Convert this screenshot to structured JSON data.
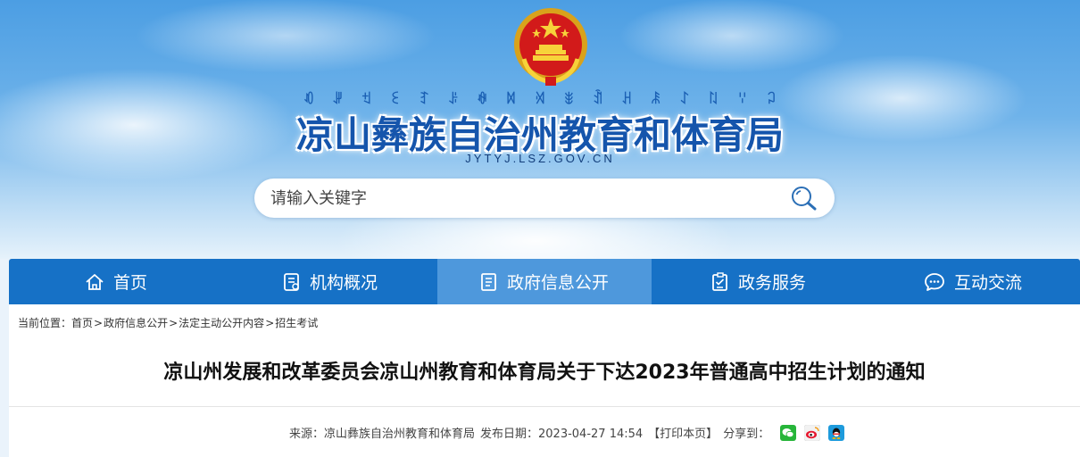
{
  "header": {
    "yi_script": [
      "ꀒ",
      "ꎼ",
      "ꉬ",
      "ꏂ",
      "ꆈ",
      "ꌠ",
      "ꊿ",
      "ꉙ",
      "ꄉ",
      "ꎺ",
      "ꀉ",
      "ꃅ",
      "ꄯ",
      "ꋍ",
      "ꇁ",
      "ꈌ",
      "ꃀ"
    ],
    "site_title": "凉山彝族自治州教育和体育局",
    "site_domain": "JYTYJ.LSZ.GOV.CN"
  },
  "search": {
    "placeholder": "请输入关键字",
    "icon": "search-icon"
  },
  "nav": {
    "items": [
      {
        "label": "首页",
        "icon": "home-icon"
      },
      {
        "label": "机构概况",
        "icon": "document-list-icon"
      },
      {
        "label": "政府信息公开",
        "icon": "info-document-icon"
      },
      {
        "label": "政务服务",
        "icon": "checklist-icon"
      },
      {
        "label": "互动交流",
        "icon": "chat-bubble-icon"
      }
    ],
    "active_index": 2
  },
  "breadcrumb": {
    "prefix": "当前位置：",
    "items": [
      "首页",
      "政府信息公开",
      "法定主动公开内容",
      "招生考试"
    ],
    "separator": ">"
  },
  "article": {
    "title": "凉山州发展和改革委员会凉山州教育和体育局关于下达2023年普通高中招生计划的通知",
    "source": "来源：凉山彝族自治州教育和体育局",
    "publish_date": "发布日期：2023-04-27 14:54",
    "print": "【打印本页】",
    "share_label": "分享到：",
    "share_icons": [
      "wechat-icon",
      "weibo-icon",
      "qq-icon"
    ]
  },
  "colors": {
    "nav_bg": "#1671c6",
    "nav_active": "#4e98dc",
    "title_blue": "#1555ac"
  }
}
